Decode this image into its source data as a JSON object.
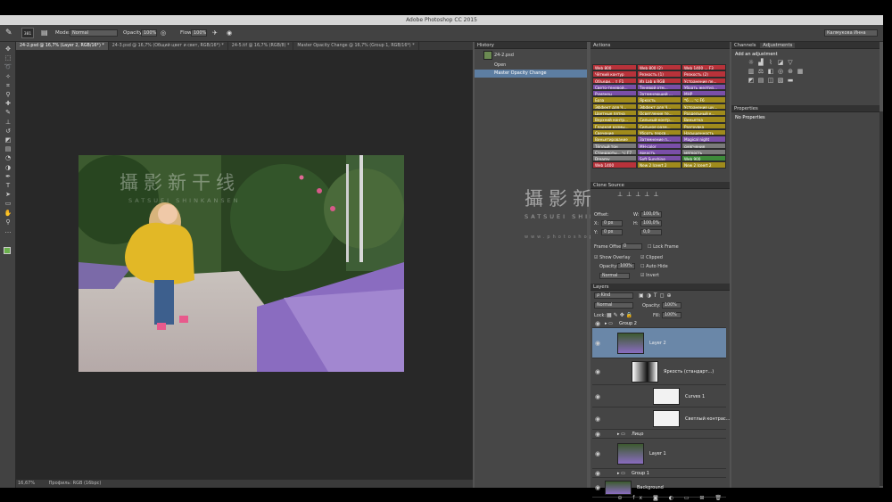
{
  "app": {
    "title": "Adobe Photoshop CC 2015"
  },
  "options_bar": {
    "mode_label": "Mode:",
    "mode_value": "Normal",
    "opacity_label": "Opacity:",
    "opacity_value": "100%",
    "flow_label": "Flow:",
    "flow_value": "100%",
    "brush_size": "381",
    "workspace": "Калмукова Инна"
  },
  "tabs": [
    "24-2.psd @ 16,7% (Layer 2, RGB/16*) *",
    "24-3.psd @ 16,7% (Общий цвет и свет, RGB/16*) *",
    "24-5.tif @ 16,7% (RGB/8) *",
    "Master Opacity Change @ 16,7% (Group 1, RGB/16*) *"
  ],
  "watermark": {
    "cn": "攝影新干线",
    "latin": "SATSUEI SHINKANSEN",
    "url": "www.photoshop.org.cn"
  },
  "statusbar": {
    "zoom": "16,67%",
    "info": "Профиль: RGB (16bpc)"
  },
  "history": {
    "title": "History",
    "snapshot": "24-2.psd",
    "items": [
      "Open",
      "Master Opacity Change"
    ]
  },
  "actions": {
    "title": "Actions",
    "items": [
      {
        "label": "Web 800",
        "color": "#b8323a"
      },
      {
        "label": "Web 800 (2)",
        "color": "#b8323a"
      },
      {
        "label": "Web 1400 ... F3",
        "color": "#b8323a"
      },
      {
        "label": "Чёткий контур",
        "color": "#b8323a"
      },
      {
        "label": "Резкость (1)",
        "color": "#b8323a"
      },
      {
        "label": "Резкость (2)",
        "color": "#b8323a"
      },
      {
        "label": "Объеди... ⇧ F1",
        "color": "#b8323a"
      },
      {
        "label": "Из Lab в RGB",
        "color": "#b8323a"
      },
      {
        "label": "Устранение пе...",
        "color": "#b8323a"
      },
      {
        "label": "Свето-теневой...",
        "color": "#7a4fa8"
      },
      {
        "label": "Теневой отм...",
        "color": "#7a4fa8"
      },
      {
        "label": "Убрать желтиз...",
        "color": "#7a4fa8"
      },
      {
        "label": "Румянец",
        "color": "#7a4fa8"
      },
      {
        "label": "Затемняющий ...",
        "color": "#7a4fa8"
      },
      {
        "label": "МНР",
        "color": "#7a4fa8"
      },
      {
        "label": "База",
        "color": "#a08b1c"
      },
      {
        "label": "Яркость",
        "color": "#a08b1c"
      },
      {
        "label": "*6 ... ⌥ F6",
        "color": "#a08b1c"
      },
      {
        "label": "Эффект для Ч...",
        "color": "#a08b1c"
      },
      {
        "label": "Эффект для Ч...",
        "color": "#a08b1c"
      },
      {
        "label": "Устранение шу...",
        "color": "#a08b1c"
      },
      {
        "label": "Цветные пятна",
        "color": "#a08b1c"
      },
      {
        "label": "Осветление те...",
        "color": "#a08b1c"
      },
      {
        "label": "Раздельный к...",
        "color": "#a08b1c"
      },
      {
        "label": "Верхний контр...",
        "color": "#a08b1c"
      },
      {
        "label": "Сильный контр...",
        "color": "#a08b1c"
      },
      {
        "label": "Виньетка",
        "color": "#a08b1c"
      },
      {
        "label": "Гладкая размы...",
        "color": "#a08b1c"
      },
      {
        "label": "Сильное разм...",
        "color": "#a08b1c"
      },
      {
        "label": "Разгрувка",
        "color": "#a08b1c"
      },
      {
        "label": "Свечение",
        "color": "#a08b1c"
      },
      {
        "label": "Убрать персв...",
        "color": "#a08b1c"
      },
      {
        "label": "Насыщенность",
        "color": "#a08b1c"
      },
      {
        "label": "Виньетирование",
        "color": "#a08b1c"
      },
      {
        "label": "Затемнение п...",
        "color": "#7a4fa8"
      },
      {
        "label": "Magical night",
        "color": "#7a4fa8"
      },
      {
        "label": "Тёплый тон",
        "color": "#7a7a7a"
      },
      {
        "label": "МН-color",
        "color": "#7a4fa8"
      },
      {
        "label": "смягчение",
        "color": "#7a7a7a"
      },
      {
        "label": "Стандарты... ⌥ F7",
        "color": "#7a7a7a"
      },
      {
        "label": "яркость",
        "color": "#7a4fa8"
      },
      {
        "label": "мягкость",
        "color": "#7a7a7a"
      },
      {
        "label": "Dreamy",
        "color": "#7a7a7a"
      },
      {
        "label": "Soft Sunshine",
        "color": "#7a4fa8"
      },
      {
        "label": "Web 900",
        "color": "#3d8a3a"
      },
      {
        "label": "Web 1400",
        "color": "#b8323a"
      },
      {
        "label": "New 2 Iceert 2",
        "color": "#a08b1c"
      },
      {
        "label": "New 2 Iceert 2",
        "color": "#a08b1c"
      }
    ]
  },
  "clone_source": {
    "title": "Clone Source",
    "offset_label": "Offset:",
    "x_label": "X:",
    "x_value": "0 px",
    "y_label": "Y:",
    "y_value": "0 px",
    "w_label": "W:",
    "w_value": "100,0%",
    "h_label": "H:",
    "h_value": "100,0%",
    "angle_value": "0,0",
    "frame_offset_label": "Frame Offset:",
    "frame_offset_value": "0",
    "lock_frame": "Lock Frame",
    "show_overlay": "Show Overlay",
    "opacity_label": "Opacity:",
    "opacity_value": "100%",
    "blend": "Normal",
    "clipped": "Clipped",
    "auto_hide": "Auto Hide",
    "invert": "Invert"
  },
  "channels": {
    "tabs": [
      "Channels",
      "Adjustments"
    ],
    "add_adjustment": "Add an adjustment"
  },
  "properties": {
    "title": "Properties",
    "empty": "No Properties"
  },
  "layers_panel": {
    "title": "Layers",
    "kind": "ρ Kind",
    "blend_mode": "Normal",
    "opacity_label": "Opacity:",
    "opacity_value": "100%",
    "lock_label": "Lock:",
    "fill_label": "Fill:",
    "fill_value": "100%",
    "layers": [
      {
        "name": "Group 2",
        "type": "group"
      },
      {
        "name": "Layer 2",
        "type": "photo",
        "selected": true
      },
      {
        "name": "Яркость (стандарт...)",
        "type": "group-mask"
      },
      {
        "name": "Curves 1",
        "type": "adjustment"
      },
      {
        "name": "Светлый контрас...",
        "type": "adjustment"
      },
      {
        "name": "Лицо",
        "type": "group"
      },
      {
        "name": "Layer 1",
        "type": "photo"
      },
      {
        "name": "Group 1",
        "type": "group"
      },
      {
        "name": "Background",
        "type": "photo"
      }
    ]
  },
  "colors": {
    "accent_selection": "#6a87a8",
    "history_selection": "#5d7ea2",
    "panel_bg": "#454545",
    "canvas_bg": "#282828"
  }
}
